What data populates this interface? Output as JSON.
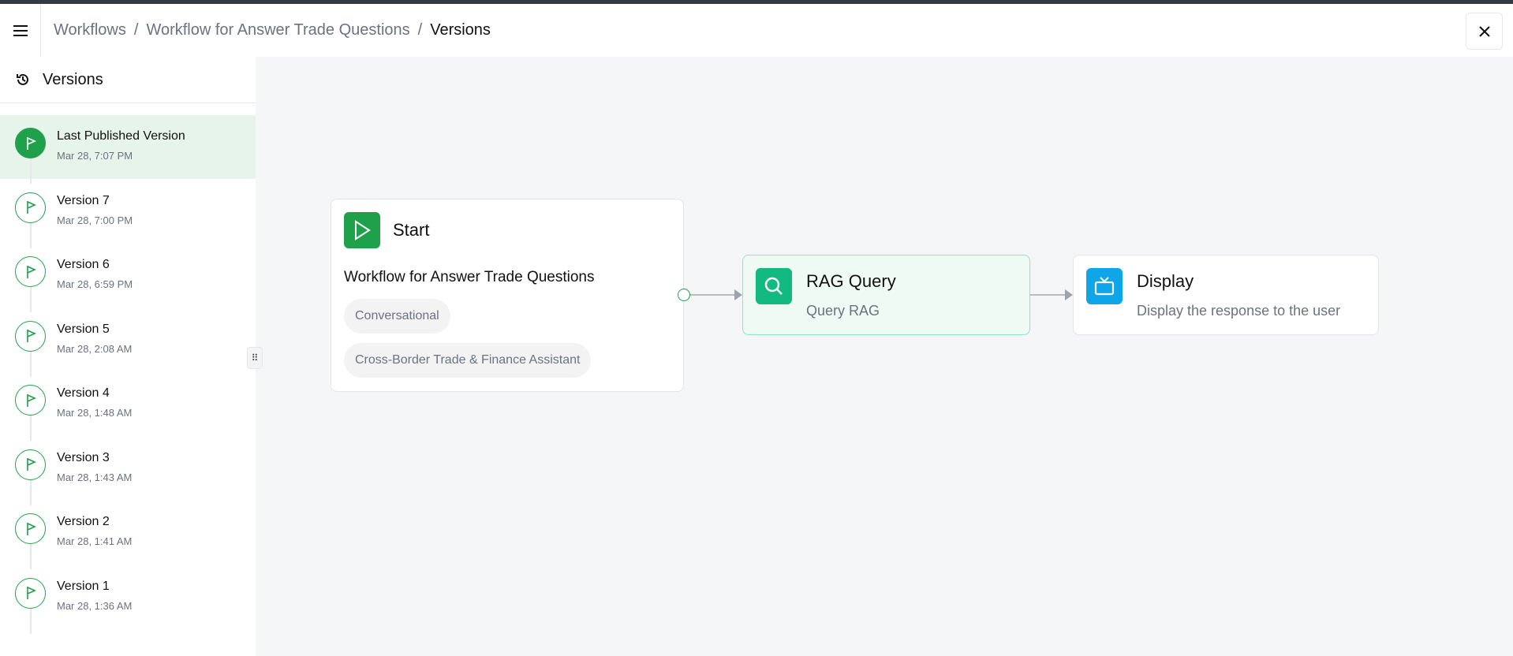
{
  "header": {
    "breadcrumbs": [
      "Workflows",
      "Workflow for Answer Trade Questions",
      "Versions"
    ]
  },
  "sidebar": {
    "title": "Versions",
    "items": [
      {
        "name": "Last Published Version",
        "date": "Mar 28, 7:07 PM"
      },
      {
        "name": "Version 7",
        "date": "Mar 28, 7:00 PM"
      },
      {
        "name": "Version 6",
        "date": "Mar 28, 6:59 PM"
      },
      {
        "name": "Version 5",
        "date": "Mar 28, 2:08 AM"
      },
      {
        "name": "Version 4",
        "date": "Mar 28, 1:48 AM"
      },
      {
        "name": "Version 3",
        "date": "Mar 28, 1:43 AM"
      },
      {
        "name": "Version 2",
        "date": "Mar 28, 1:41 AM"
      },
      {
        "name": "Version 1",
        "date": "Mar 28, 1:36 AM"
      }
    ]
  },
  "nodes": {
    "start": {
      "title": "Start",
      "name": "Workflow for Answer Trade Questions",
      "tags": [
        "Conversational",
        "Cross-Border Trade & Finance Assistant"
      ]
    },
    "rag": {
      "title": "RAG Query",
      "subtitle": "Query RAG"
    },
    "display": {
      "title": "Display",
      "subtitle": "Display the response to the user"
    }
  },
  "colors": {
    "green": "#1fa04a",
    "rag": "#12b981",
    "display": "#0ea5e9",
    "selected_bg": "#e7f4ea"
  }
}
